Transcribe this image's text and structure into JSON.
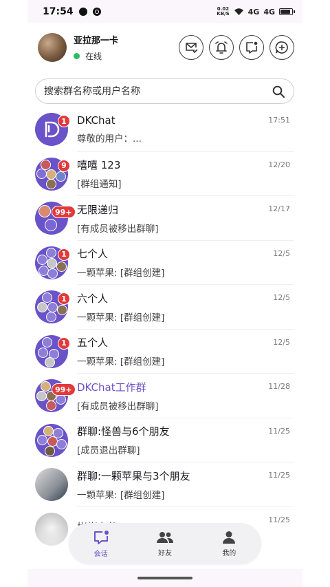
{
  "status_bar": {
    "time": "17:54",
    "net_speed_value": "0.02",
    "net_speed_unit": "KB/S",
    "signal1": "4G",
    "signal2": "4G"
  },
  "header": {
    "username": "亚拉那一卡",
    "status": "在线"
  },
  "search": {
    "placeholder": "搜索群名称或用户名称"
  },
  "conversations": [
    {
      "name": "DKChat",
      "preview": "尊敬的用户：...",
      "time": "17:51",
      "badge": "1"
    },
    {
      "name": "嘻嘻 123",
      "preview": "[群组通知]",
      "time": "12/20",
      "badge": "9"
    },
    {
      "name": "无限递归",
      "preview": "[有成员被移出群聊]",
      "time": "12/17",
      "badge": "99+"
    },
    {
      "name": "七个人",
      "preview": "一颗苹果: [群组创建]",
      "time": "12/5",
      "badge": "1"
    },
    {
      "name": "六个人",
      "preview": "一颗苹果: [群组创建]",
      "time": "12/5",
      "badge": "1"
    },
    {
      "name": "五个人",
      "preview": "一颗苹果: [群组创建]",
      "time": "12/5",
      "badge": "1"
    },
    {
      "name": "DKChat工作群",
      "preview": "[有成员被移出群聊]",
      "time": "11/28",
      "badge": "99+"
    },
    {
      "name": "群聊:怪兽与6个朋友",
      "preview": "[成员退出群聊]",
      "time": "11/25",
      "badge": ""
    },
    {
      "name": "群聊:一颗苹果与3个朋友",
      "preview": "一颗苹果: [群组创建]",
      "time": "11/25",
      "badge": ""
    },
    {
      "name": "彬彬有礼",
      "preview": "",
      "time": "11/25",
      "badge": ""
    }
  ],
  "nav": [
    {
      "label": "会话",
      "icon": "chat-icon",
      "active": true
    },
    {
      "label": "好友",
      "icon": "friends-icon",
      "active": false
    },
    {
      "label": "我的",
      "icon": "profile-icon",
      "active": false
    }
  ],
  "colors": {
    "accent": "#6a52c9",
    "badge": "#e23a3a",
    "online": "#2bbb62"
  }
}
